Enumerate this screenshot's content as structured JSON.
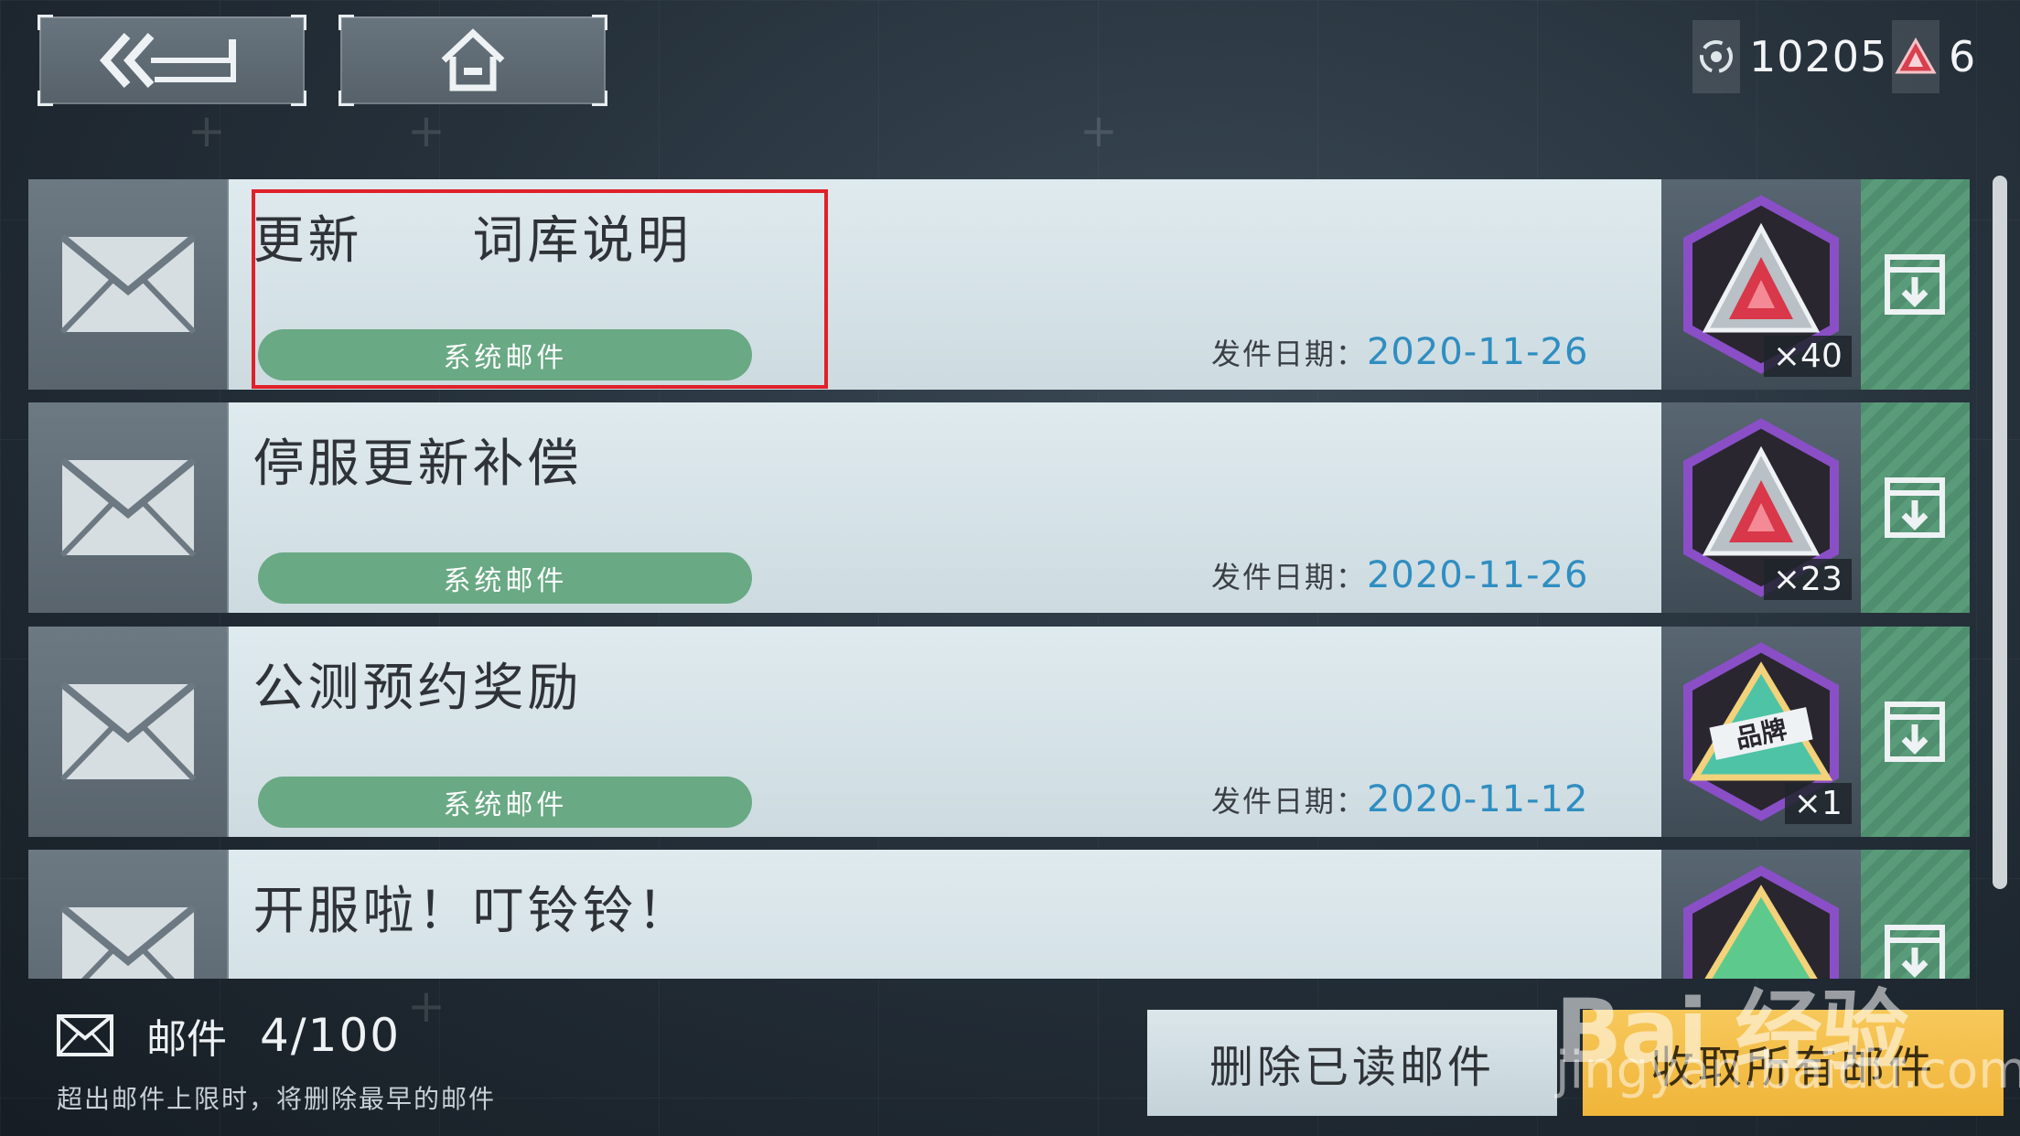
{
  "topbar": {
    "back_icon": "double-chevron-back-icon",
    "home_icon": "home-icon"
  },
  "currency": [
    {
      "icon": "crystal-coin-icon",
      "value": "10205"
    },
    {
      "icon": "red-triangle-gem-icon",
      "value": "6"
    }
  ],
  "mails": [
    {
      "title": "更新　　词库说明",
      "tag": "系统邮件",
      "date_label": "发件日期：",
      "date": "2020-11-26",
      "reward_icon": "red-crystal-hexagon-icon",
      "reward_count": "×40"
    },
    {
      "title": "停服更新补偿",
      "tag": "系统邮件",
      "date_label": "发件日期：",
      "date": "2020-11-26",
      "reward_icon": "red-crystal-hexagon-icon",
      "reward_count": "×23"
    },
    {
      "title": "公测预约奖励",
      "tag": "系统邮件",
      "date_label": "发件日期：",
      "date": "2020-11-12",
      "reward_icon": "brand-triangle-badge-icon",
      "reward_count": "×1"
    },
    {
      "title": "开服啦！叮铃铃！",
      "tag": "",
      "date_label": "",
      "date": "",
      "reward_icon": "green-triangle-badge-icon",
      "reward_count": ""
    }
  ],
  "footer": {
    "mail_label": "邮件",
    "mail_count": "4/100",
    "note": "超出邮件上限时，将删除最早的邮件",
    "delete_label": "删除已读邮件",
    "claim_label": "收取所有邮件"
  },
  "watermark": {
    "brand": "Bai 经验",
    "url": "jingyan.baidu.com"
  },
  "colors": {
    "tag_green": "#69a984",
    "date_blue": "#2f8ec1",
    "claim_yellow": "#f0b53a",
    "highlight_red": "#e0202a"
  }
}
